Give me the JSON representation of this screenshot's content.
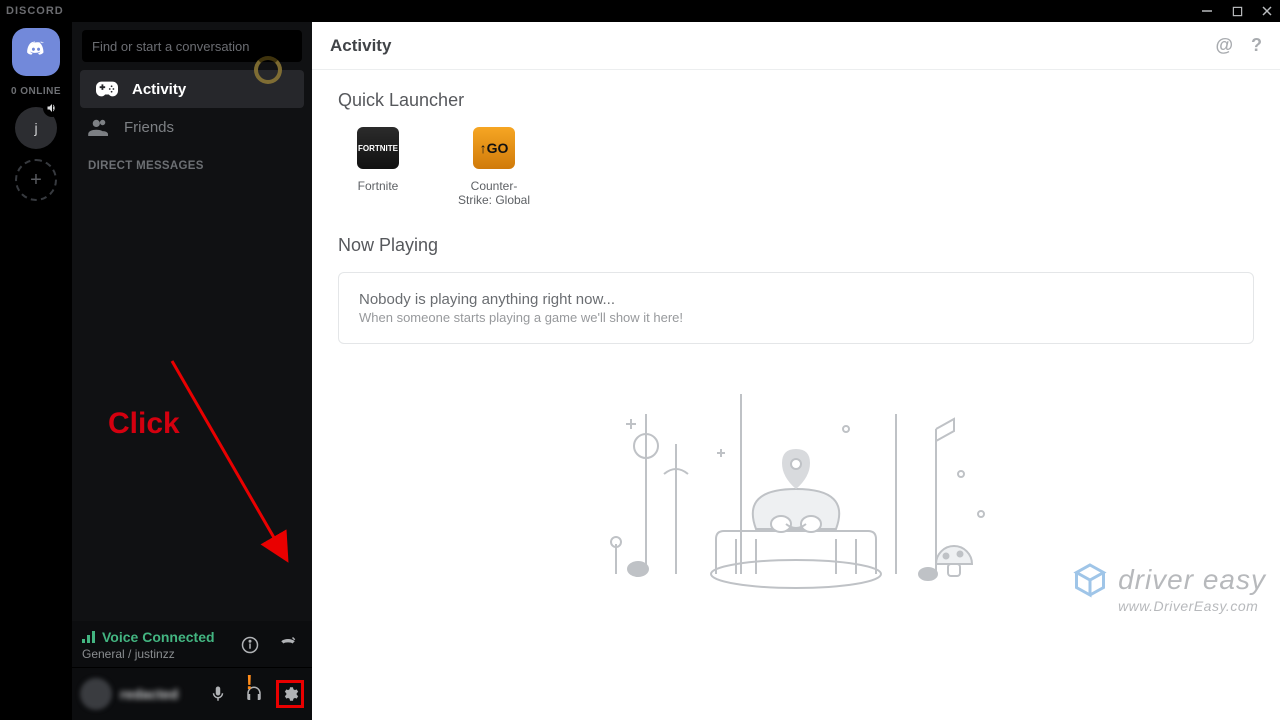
{
  "titlebar": {
    "wordmark": "DISCORD"
  },
  "servers": {
    "online_label": "0 ONLINE",
    "avatar_initial": "j"
  },
  "channels": {
    "search_placeholder": "Find or start a conversation",
    "nav": {
      "activity": "Activity",
      "friends": "Friends"
    },
    "dm_header": "DIRECT MESSAGES",
    "click_annotation": "Click"
  },
  "voice": {
    "status": "Voice Connected",
    "channel": "General / justinzz"
  },
  "user": {
    "display_name": "redacted"
  },
  "content": {
    "header_title": "Activity",
    "quick_launcher": {
      "title": "Quick Launcher",
      "items": [
        {
          "label": "Fortnite",
          "badge": "FORTNITE"
        },
        {
          "label": "Counter-Strike: Global",
          "badge": "GO"
        }
      ]
    },
    "now_playing": {
      "title": "Now Playing",
      "empty_line1": "Nobody is playing anything right now...",
      "empty_line2": "When someone starts playing a game we'll show it here!"
    }
  },
  "watermark": {
    "brand": "driver easy",
    "url": "www.DriverEasy.com"
  }
}
